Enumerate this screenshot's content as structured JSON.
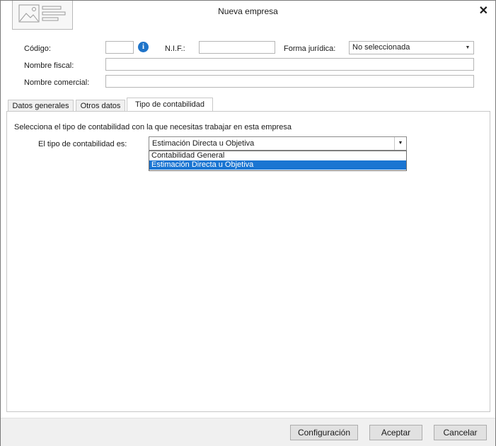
{
  "window": {
    "title": "Nueva empresa",
    "close_glyph": "✕"
  },
  "fields": {
    "codigo_label": "Código:",
    "codigo_value": "",
    "nif_label": "N.I.F.:",
    "nif_value": "",
    "forma_label": "Forma jurídica:",
    "forma_value": "No seleccionada",
    "nombre_fiscal_label": "Nombre fiscal:",
    "nombre_fiscal_value": "",
    "nombre_comercial_label": "Nombre comercial:",
    "nombre_comercial_value": "",
    "info_glyph": "i"
  },
  "tabs": [
    {
      "label": "Datos generales"
    },
    {
      "label": "Otros datos"
    },
    {
      "label": "Tipo de contabilidad"
    }
  ],
  "panel": {
    "intro": "Selecciona el tipo de contabilidad con la que necesitas trabajar en esta empresa",
    "tipo_label": "El tipo de contabilidad es:",
    "tipo_value": "Estimación Directa u Objetiva",
    "options": [
      {
        "label": "Contabilidad General"
      },
      {
        "label": "Estimación Directa u Objetiva"
      }
    ]
  },
  "footer": {
    "config": "Configuración",
    "accept": "Aceptar",
    "cancel": "Cancelar"
  },
  "colors": {
    "accent": "#1a75d2",
    "info": "#1f74c9"
  },
  "icons": {
    "logo": "image-placeholder-icon",
    "info": "info-icon",
    "close": "close-icon",
    "dropdown": "chevron-down-icon"
  }
}
